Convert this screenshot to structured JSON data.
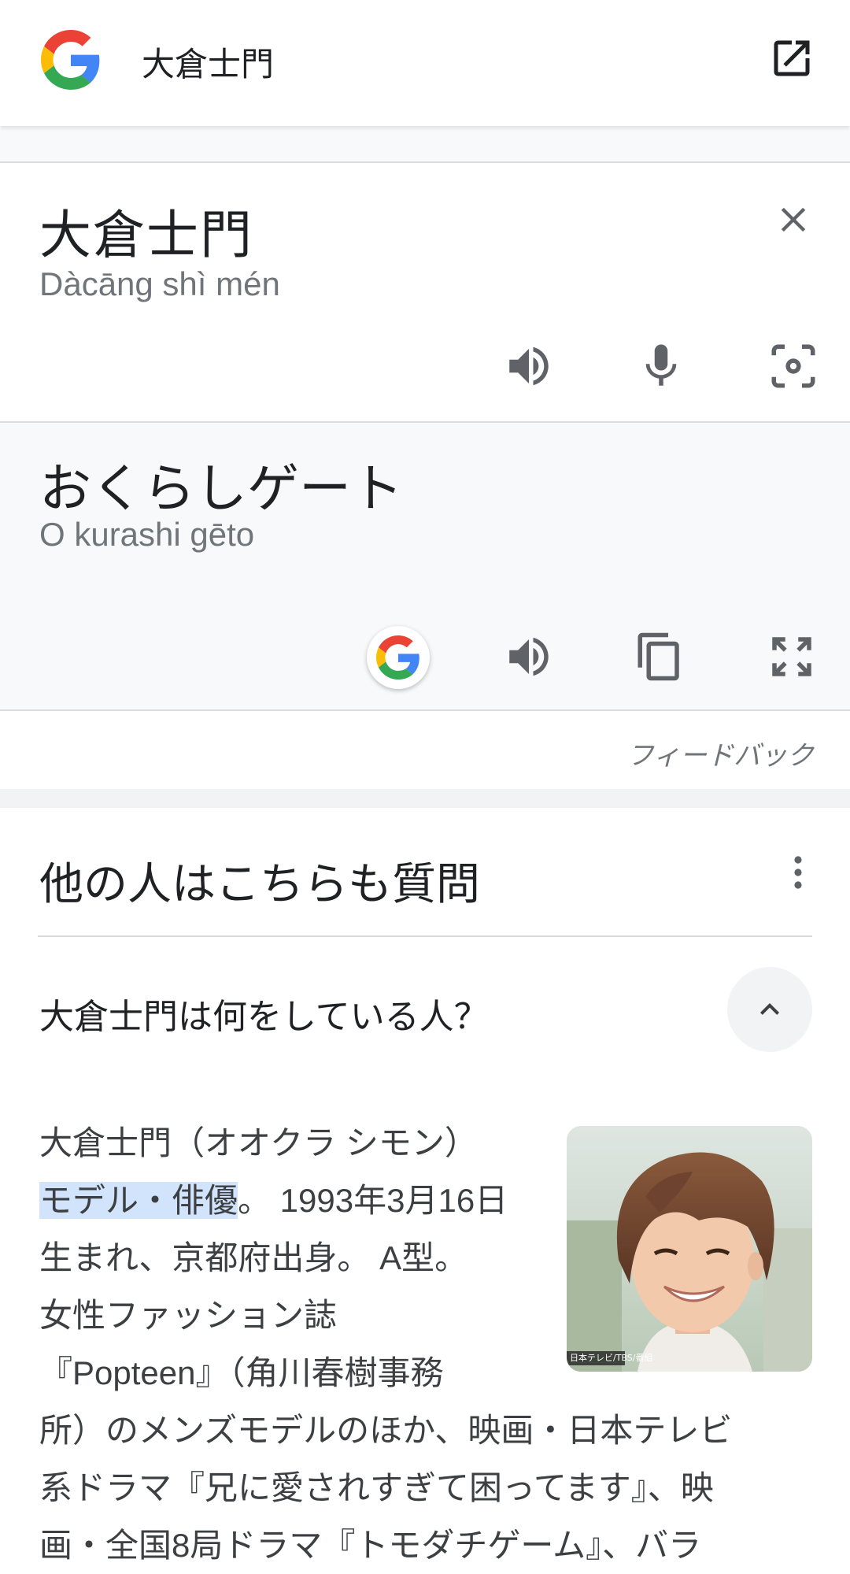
{
  "top_bar": {
    "query": "大倉士門",
    "logo_icon": "google-g-icon",
    "open_icon": "open-in-new-icon"
  },
  "source": {
    "text": "大倉士門",
    "romanization": "Dàcāng shì mén",
    "icons": [
      "close-icon",
      "speaker-icon",
      "mic-icon",
      "camera-icon"
    ]
  },
  "target": {
    "text": "おくらしゲート",
    "romanization": "O kurashi gēto",
    "icons": [
      "google-g-icon",
      "speaker-icon",
      "copy-icon",
      "fullscreen-icon"
    ]
  },
  "feedback_label": "フィードバック",
  "people_also_ask": {
    "title": "他の人はこちらも質問",
    "question_1": "大倉士門は何をしている人？",
    "answer": {
      "line1": "大倉士門（オオクラ シモン）",
      "highlight": "モデル・俳優",
      "line2_rest": "。 1993年3月16日",
      "line3": "生まれ、京都府出身。 A型。",
      "line4": "女性ファッション誌",
      "line5": "『Popteen』（角川春樹事務",
      "line6": "所）のメンズモデルのほか、映画・日本テレビ",
      "line7": "系ドラマ『兄に愛されすぎて困ってます』、映",
      "line8": "画・全国8局ドラマ『トモダチゲーム』、バラ"
    },
    "photo_caption": "日本テレビ/TBS/番組"
  },
  "colors": {
    "google_blue": "#4285F4",
    "google_red": "#EA4335",
    "google_yellow": "#FBBC05",
    "google_green": "#34A853",
    "highlight": "#d2e3fc"
  }
}
